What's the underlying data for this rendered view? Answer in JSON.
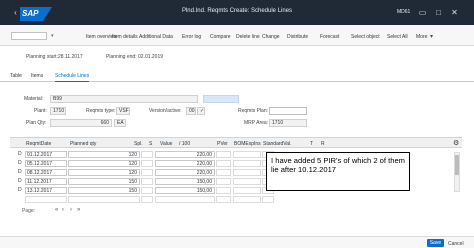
{
  "titlebar": {
    "logo": "SAP",
    "title": "Plnd.Ind. Reqmts Create: Schedule Lines",
    "system": "MD61",
    "icons": [
      "back-icon",
      "close-icon",
      "minimize-icon",
      "maximize-icon",
      "exit-icon"
    ]
  },
  "toolbar": {
    "command_field": "",
    "buttons": [
      "Item overview",
      "Item details",
      "Additional Data",
      "Error log",
      "Compare",
      "Delete line",
      "Change",
      "Distribute",
      "Forecast",
      "Select object",
      "Select All"
    ],
    "more_label": "More",
    "more_icon": "chevron-down-icon"
  },
  "info": {
    "start_label": "Planning start:",
    "start_value": "28.11.2017",
    "end_label": "Planning end:",
    "end_value": "02.01.2019"
  },
  "tabs": [
    "Table",
    "Items",
    "Schedule Lines"
  ],
  "form": {
    "material_label": "Material:",
    "material_value": "B99",
    "plant_label": "Plant:",
    "plant_value": "1710",
    "reqmts_type_label": "Reqmts type:",
    "reqmts_type_value": "VSF",
    "version_label": "Version/active:",
    "version_value": "00",
    "active_value": "✓",
    "reqmts_plan_label": "Reqmts Plan:",
    "reqmts_plan_value": "",
    "plan_qty_label": "Plan Qty:",
    "plan_qty_value": "660",
    "uom_value": "EA",
    "mrp_area_label": "MRP Area:",
    "mrp_area_value": "1710"
  },
  "grid": {
    "headers": [
      "ReqmtDate",
      "Planned qty",
      "Spl.",
      "S",
      "Value",
      "/ 100",
      "PVer",
      "BOMExpIns",
      "StandardVal.",
      "T",
      "R"
    ],
    "settings_icon": "settings-icon",
    "rows": [
      {
        "period": "D",
        "date": "01.12.2017",
        "qty": "120",
        "value": "220,00"
      },
      {
        "period": "D",
        "date": "05.12.2017",
        "qty": "120",
        "value": "220,00"
      },
      {
        "period": "D",
        "date": "08.12.2017",
        "qty": "120",
        "value": "220,00"
      },
      {
        "period": "D",
        "date": "11.12.2017",
        "qty": "150",
        "value": "150,00"
      },
      {
        "period": "D",
        "date": "13.12.2017",
        "qty": "150",
        "value": "150,00"
      }
    ]
  },
  "callout": {
    "text": "I have added 5 PIR's of which 2 of them lie after 10.12.2017"
  },
  "pager": {
    "label": "Page:",
    "icons": [
      "first-page-icon",
      "prev-page-icon",
      "next-page-icon",
      "last-page-icon"
    ]
  },
  "footer": {
    "save_label": "Save",
    "cancel_label": "Cancel"
  },
  "colors": {
    "shell": "#1f2a36",
    "accent": "#0a6ed1",
    "grid_header": "#eef0f2"
  }
}
